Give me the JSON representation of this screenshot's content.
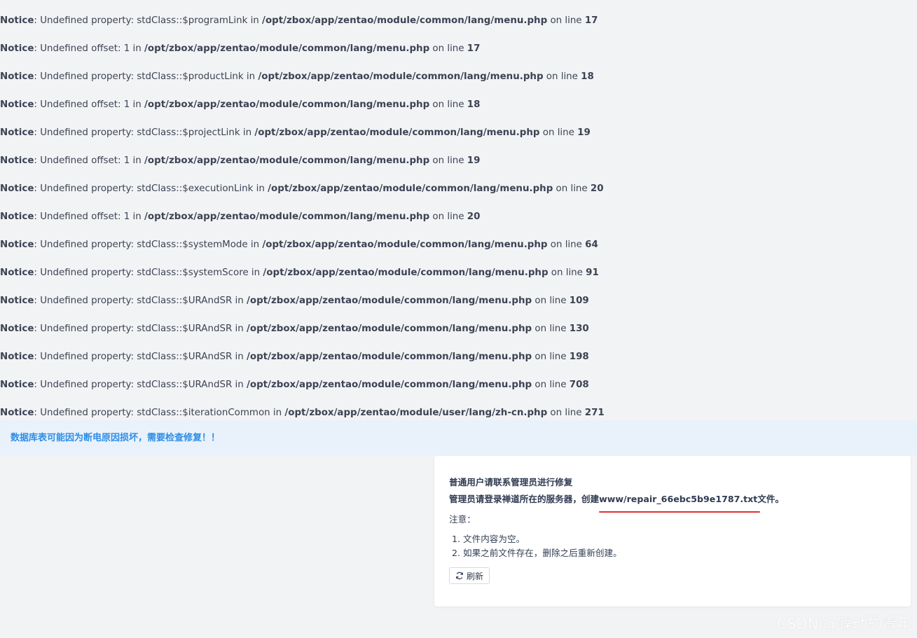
{
  "notices": [
    {
      "label": "Notice",
      "message": ": Undefined property: stdClass::$programLink in ",
      "file": "/opt/zbox/app/zentao/module/common/lang/menu.php",
      "online": " on line ",
      "line": "17"
    },
    {
      "label": "Notice",
      "message": ": Undefined offset: 1 in ",
      "file": "/opt/zbox/app/zentao/module/common/lang/menu.php",
      "online": " on line ",
      "line": "17"
    },
    {
      "label": "Notice",
      "message": ": Undefined property: stdClass::$productLink in ",
      "file": "/opt/zbox/app/zentao/module/common/lang/menu.php",
      "online": " on line ",
      "line": "18"
    },
    {
      "label": "Notice",
      "message": ": Undefined offset: 1 in ",
      "file": "/opt/zbox/app/zentao/module/common/lang/menu.php",
      "online": " on line ",
      "line": "18"
    },
    {
      "label": "Notice",
      "message": ": Undefined property: stdClass::$projectLink in ",
      "file": "/opt/zbox/app/zentao/module/common/lang/menu.php",
      "online": " on line ",
      "line": "19"
    },
    {
      "label": "Notice",
      "message": ": Undefined offset: 1 in ",
      "file": "/opt/zbox/app/zentao/module/common/lang/menu.php",
      "online": " on line ",
      "line": "19"
    },
    {
      "label": "Notice",
      "message": ": Undefined property: stdClass::$executionLink in ",
      "file": "/opt/zbox/app/zentao/module/common/lang/menu.php",
      "online": " on line ",
      "line": "20"
    },
    {
      "label": "Notice",
      "message": ": Undefined offset: 1 in ",
      "file": "/opt/zbox/app/zentao/module/common/lang/menu.php",
      "online": " on line ",
      "line": "20"
    },
    {
      "label": "Notice",
      "message": ": Undefined property: stdClass::$systemMode in ",
      "file": "/opt/zbox/app/zentao/module/common/lang/menu.php",
      "online": " on line ",
      "line": "64"
    },
    {
      "label": "Notice",
      "message": ": Undefined property: stdClass::$systemScore in ",
      "file": "/opt/zbox/app/zentao/module/common/lang/menu.php",
      "online": " on line ",
      "line": "91"
    },
    {
      "label": "Notice",
      "message": ": Undefined property: stdClass::$URAndSR in ",
      "file": "/opt/zbox/app/zentao/module/common/lang/menu.php",
      "online": " on line ",
      "line": "109"
    },
    {
      "label": "Notice",
      "message": ": Undefined property: stdClass::$URAndSR in ",
      "file": "/opt/zbox/app/zentao/module/common/lang/menu.php",
      "online": " on line ",
      "line": "130"
    },
    {
      "label": "Notice",
      "message": ": Undefined property: stdClass::$URAndSR in ",
      "file": "/opt/zbox/app/zentao/module/common/lang/menu.php",
      "online": " on line ",
      "line": "198"
    },
    {
      "label": "Notice",
      "message": ": Undefined property: stdClass::$URAndSR in ",
      "file": "/opt/zbox/app/zentao/module/common/lang/menu.php",
      "online": " on line ",
      "line": "708"
    },
    {
      "label": "Notice",
      "message": ": Undefined property: stdClass::$iterationCommon in ",
      "file": "/opt/zbox/app/zentao/module/user/lang/zh-cn.php",
      "online": " on line ",
      "line": "271"
    }
  ],
  "alert": {
    "text": "数据库表可能因为断电原因损坏，需要检查修复！！",
    "color": "#2e8ee6",
    "background": "#e9f2fb"
  },
  "repair_panel": {
    "line1": "普通用户请联系管理员进行修复",
    "line2_prefix": "管理员请登录禅道所在的服务器，创建",
    "filename": "www/repair_66ebc5b9e1787.txt",
    "line2_suffix": "文件。",
    "note_label": "注意：",
    "steps": [
      "文件内容为空。",
      "如果之前文件存在，删除之后重新创建。"
    ],
    "refresh_label": "刷新",
    "refresh_icon": "refresh-icon",
    "underline_color": "#e0312a"
  },
  "watermark": "CSDN @躁动的青年"
}
